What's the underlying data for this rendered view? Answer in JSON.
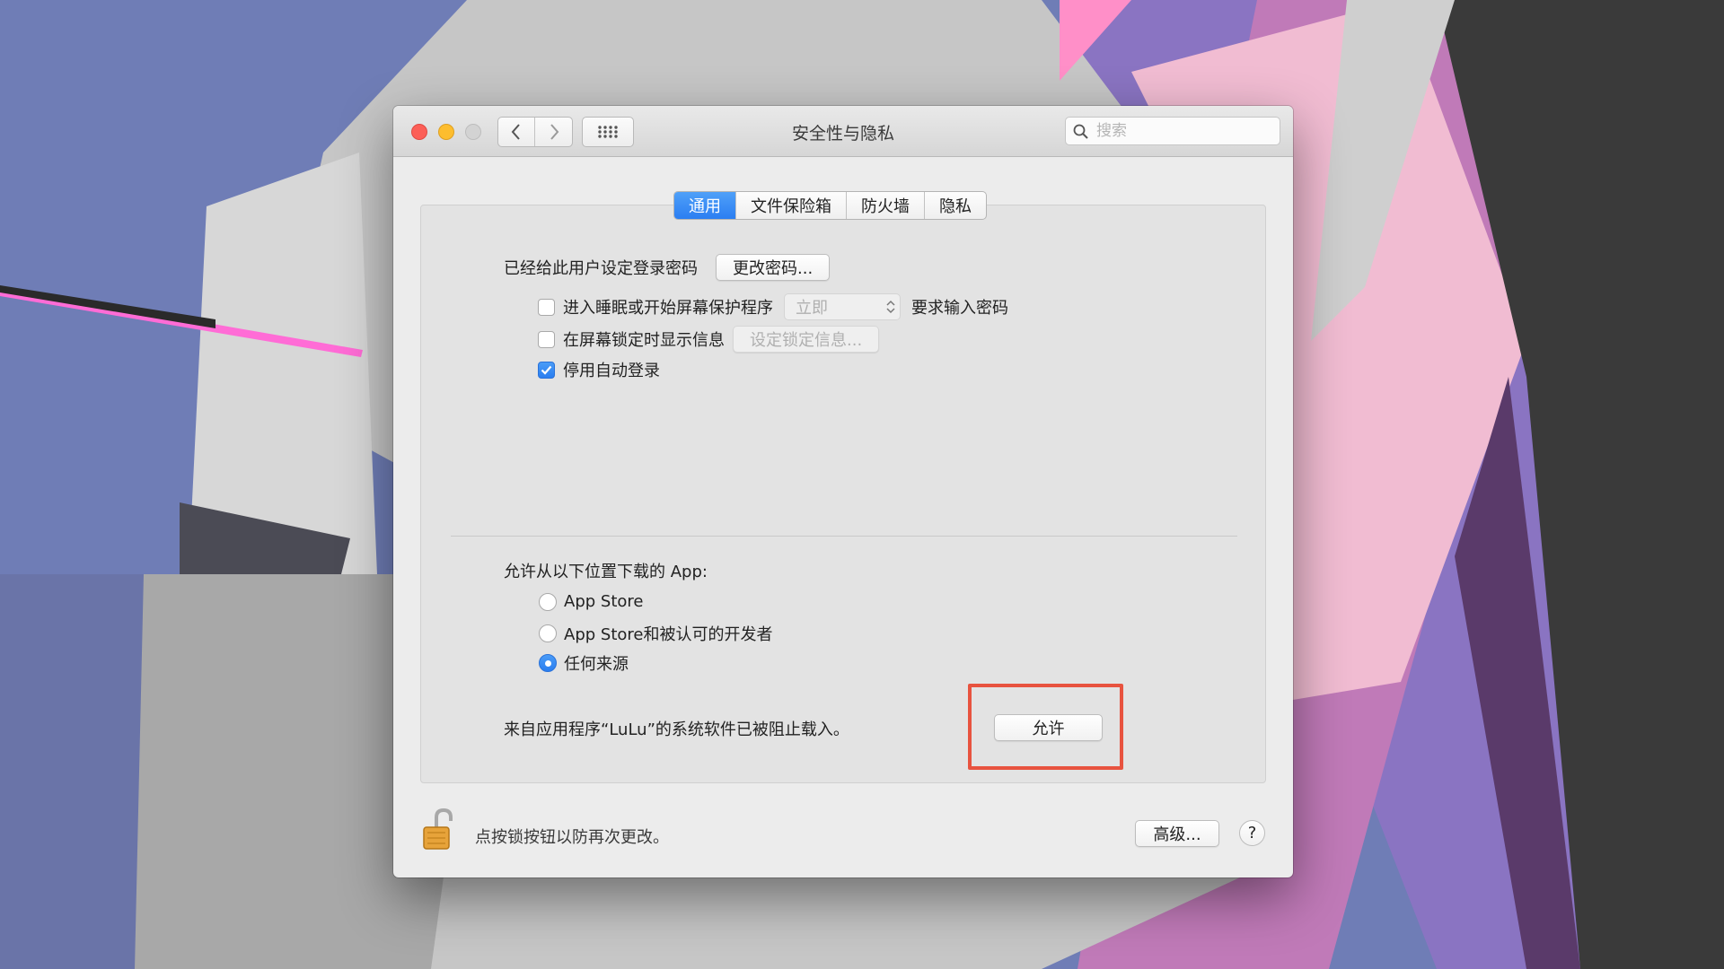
{
  "window": {
    "title": "安全性与隐私"
  },
  "toolbar": {
    "back_icon": "chevron-left-icon",
    "forward_icon": "chevron-right-icon",
    "grid_icon": "show-all-grid-icon",
    "search": {
      "placeholder": "搜索",
      "value": ""
    }
  },
  "tabs": [
    {
      "label": "通用",
      "active": true
    },
    {
      "label": "文件保险箱",
      "active": false
    },
    {
      "label": "防火墙",
      "active": false
    },
    {
      "label": "隐私",
      "active": false
    }
  ],
  "general": {
    "password_text": "已经给此用户设定登录密码",
    "change_password_button": "更改密码...",
    "require_password": {
      "label": "进入睡眠或开始屏幕保护程序",
      "checked": false,
      "select_value": "立即",
      "suffix": "要求输入密码"
    },
    "show_message": {
      "label": "在屏幕锁定时显示信息",
      "checked": false,
      "button": "设定锁定信息..."
    },
    "disable_auto_login": {
      "label": "停用自动登录",
      "checked": true
    }
  },
  "downloads": {
    "heading": "允许从以下位置下载的 App:",
    "options": [
      {
        "label": "App Store",
        "selected": false
      },
      {
        "label": "App Store和被认可的开发者",
        "selected": false
      },
      {
        "label": "任何来源",
        "selected": true
      }
    ],
    "blocked_message": "来自应用程序“LuLu”的系统软件已被阻止载入。",
    "allow_button": "允许"
  },
  "footer": {
    "lock_icon": "unlocked-padlock-icon",
    "lock_text": "点按锁按钮以防再次更改。",
    "advanced_button": "高级...",
    "help_button": "?"
  },
  "colors": {
    "accent": "#2b7ef2",
    "highlight_box": "#e8533f",
    "close": "#fc5f57",
    "minimize": "#fdbd2e",
    "zoom_inactive": "#d3d3d3"
  }
}
